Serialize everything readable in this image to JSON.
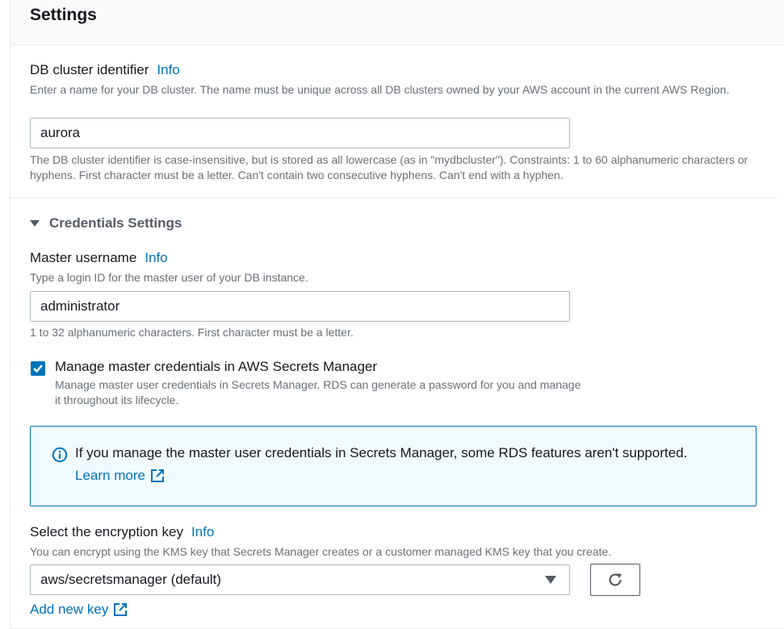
{
  "settings": {
    "title": "Settings"
  },
  "cluster_id": {
    "label": "DB cluster identifier",
    "info": "Info",
    "description": "Enter a name for your DB cluster. The name must be unique across all DB clusters owned by your AWS account in the current AWS Region.",
    "value": "aurora",
    "constraints": "The DB cluster identifier is case-insensitive, but is stored as all lowercase (as in \"mydbcluster\"). Constraints: 1 to 60 alphanumeric characters or hyphens. First character must be a letter. Can't contain two consecutive hyphens. Can't end with a hyphen."
  },
  "credentials": {
    "section_title": "Credentials Settings",
    "username_label": "Master username",
    "info": "Info",
    "username_description": "Type a login ID for the master user of your DB instance.",
    "username_value": "administrator",
    "username_constraints": "1 to 32 alphanumeric characters. First character must be a letter.",
    "manage_checkbox_label": "Manage master credentials in AWS Secrets Manager",
    "manage_checkbox_checked": true,
    "manage_checkbox_description": "Manage master user credentials in Secrets Manager. RDS can generate a password for you and manage it throughout its lifecycle.",
    "alert_text": "If you manage the master user credentials in Secrets Manager, some RDS features aren't supported.",
    "alert_link": "Learn more"
  },
  "encryption": {
    "label": "Select the encryption key",
    "info": "Info",
    "description": "You can encrypt using the KMS key that Secrets Manager creates or a customer managed KMS key that you create.",
    "selected": "aws/secretsmanager (default)",
    "add_key_link": "Add new key"
  }
}
